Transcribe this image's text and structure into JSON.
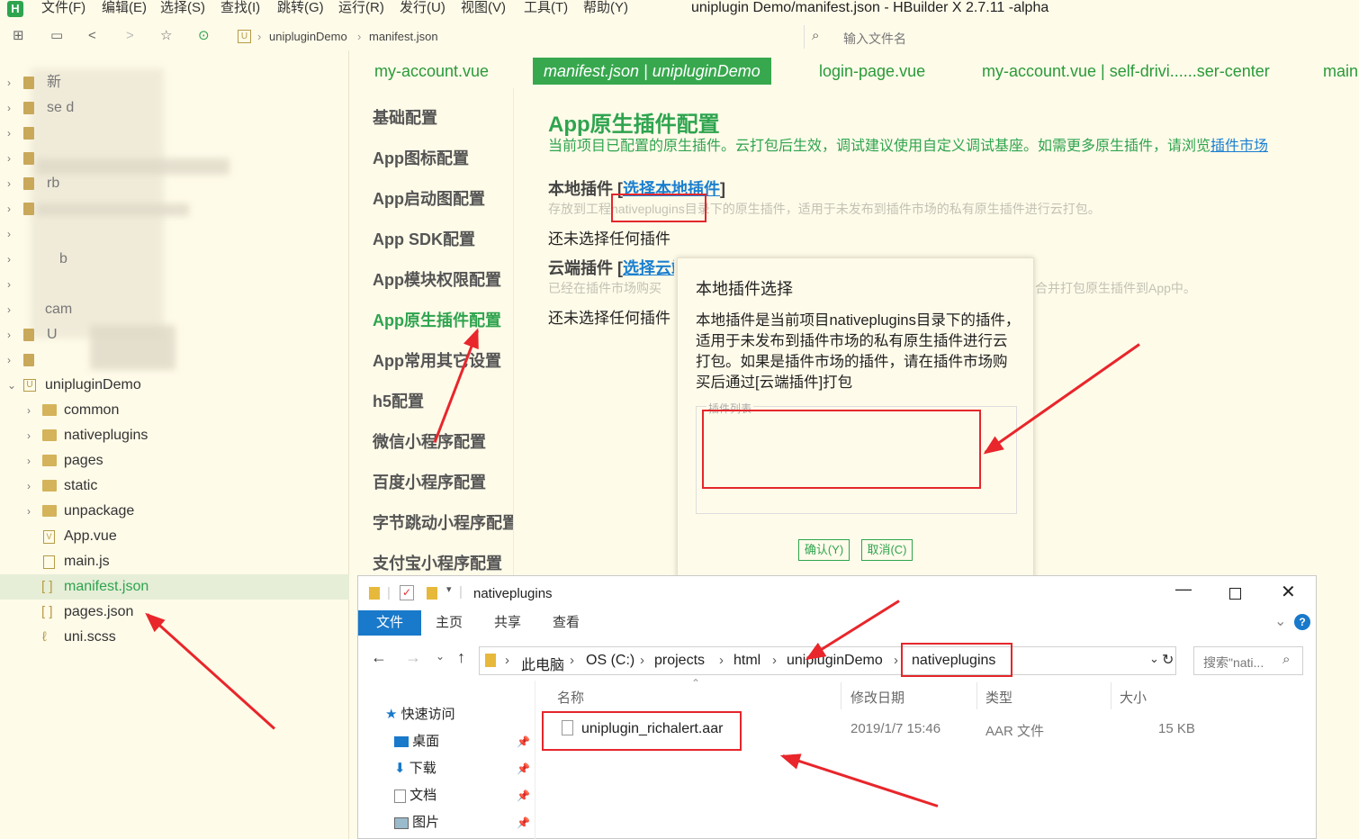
{
  "window": {
    "title": "uniplugin Demo/manifest.json - HBuilder X 2.7.11 -alpha",
    "logo": "H"
  },
  "menu": [
    "文件(F)",
    "编辑(E)",
    "选择(S)",
    "查找(I)",
    "跳转(G)",
    "运行(R)",
    "发行(U)",
    "视图(V)",
    "工具(T)",
    "帮助(Y)"
  ],
  "toolbar": {
    "breadcrumb": [
      "unipluginDemo",
      "manifest.json"
    ],
    "file_search_placeholder": "输入文件名"
  },
  "sidebar": {
    "blurred": [
      "新",
      "se d",
      "",
      "",
      "rb",
      "",
      "b",
      "cam",
      "U"
    ],
    "project": "unipluginDemo",
    "folders": [
      "common",
      "nativeplugins",
      "pages",
      "static",
      "unpackage"
    ],
    "files": [
      {
        "name": "App.vue",
        "icon": "vue-file-icon"
      },
      {
        "name": "main.js",
        "icon": "js-file-icon"
      },
      {
        "name": "manifest.json",
        "icon": "json-file-icon",
        "selected": true
      },
      {
        "name": "pages.json",
        "icon": "json-file-icon"
      },
      {
        "name": "uni.scss",
        "icon": "scss-file-icon"
      }
    ]
  },
  "tabs": [
    "my-account.vue",
    "manifest.json | unipluginDemo",
    "login-page.vue",
    "my-account.vue | self-drivi......ser-center",
    "main"
  ],
  "config_nav": [
    "基础配置",
    "App图标配置",
    "App启动图配置",
    "App SDK配置",
    "App模块权限配置",
    "App原生插件配置",
    "App常用其它设置",
    "h5配置",
    "微信小程序配置",
    "百度小程序配置",
    "字节跳动小程序配置",
    "支付宝小程序配置"
  ],
  "config_nav_active": 5,
  "main": {
    "title": "App原生插件配置",
    "desc_pre": "当前项目已配置的原生插件。云打包后生效，调试建议使用自定义调试基座。如需更多原生插件，请浏览",
    "desc_link": "插件市场",
    "local_title": "本地插件",
    "local_link": "选择本地插件",
    "local_note_a": "存放到工程",
    "local_note_dir": "nativeplugins",
    "local_note_b": "目录下的原生插件，适用于未发布到插件市场的私有原生插件进行云打包。",
    "none_selected": "还未选择任何插件",
    "cloud_title": "云端插件",
    "cloud_link": "选择云端插件",
    "cloud_note_a": "已经在插件市场购买",
    "cloud_note_b": "合并打包原生插件到App中。",
    "none_selected_2": "还未选择任何插件"
  },
  "dialog": {
    "title": "本地插件选择",
    "desc": "本地插件是当前项目nativeplugins目录下的插件，适用于未发布到插件市场的私有原生插件进行云打包。如果是插件市场的插件，请在插件市场购买后通过[云端插件]打包",
    "list_label": "插件列表",
    "ok": "确认(Y)",
    "cancel": "取消(C)"
  },
  "explorer": {
    "title": "nativeplugins",
    "ribbon": [
      "文件",
      "主页",
      "共享",
      "查看"
    ],
    "path": [
      "此电脑",
      "OS (C:)",
      "projects",
      "html",
      "unipluginDemo",
      "nativeplugins"
    ],
    "search_placeholder": "搜索\"nati...",
    "quick_access": "快速访问",
    "nav": [
      "桌面",
      "下载",
      "文档",
      "图片"
    ],
    "columns": [
      "名称",
      "修改日期",
      "类型",
      "大小"
    ],
    "files": [
      {
        "name": "uniplugin_richalert.aar",
        "date": "2019/1/7 15:46",
        "type": "AAR 文件",
        "size": "15 KB"
      }
    ]
  },
  "colors": {
    "accent": "#2ea44f",
    "annotation": "#e4262b",
    "background": "#fffbe9",
    "link": "#1a7fd0"
  }
}
